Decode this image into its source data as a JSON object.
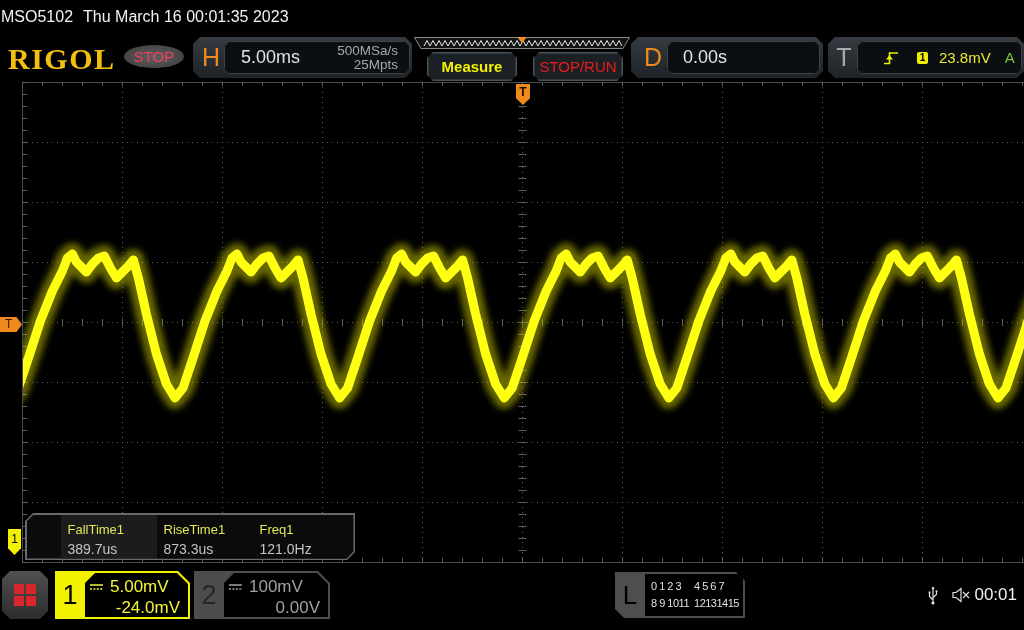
{
  "status_line": {
    "model": "MSO5102",
    "datetime": "Thu March 16 00:01:35 2023"
  },
  "toolbar": {
    "logo": "RIGOL",
    "run_state": {
      "label": "STOP",
      "running": false
    },
    "horizontal": {
      "label": "H",
      "timebase": "5.00ms",
      "sample_rate": "500MSa/s",
      "memory_depth": "25Mpts"
    },
    "buttons": [
      {
        "label": "Measure",
        "kind": "measure"
      },
      {
        "label": "STOP/RUN",
        "kind": "run_stop"
      }
    ],
    "delay": {
      "label": "D",
      "value": "0.00s"
    },
    "trigger": {
      "label": "T",
      "source": "1",
      "level": "23.8mV",
      "mode": "A"
    }
  },
  "display": {
    "trigger_position_marker": "T",
    "trigger_level_marker": "T",
    "channel_marker": "1",
    "measurements": [
      {
        "name": "FallTime1",
        "value": "389.7us",
        "selected": true
      },
      {
        "name": "RiseTime1",
        "value": "873.3us",
        "selected": false
      },
      {
        "name": "Freq1",
        "value": "121.0Hz",
        "selected": false
      }
    ]
  },
  "footer": {
    "channels": [
      {
        "number": "1",
        "scale": "5.00mV",
        "offset": "-24.0mV",
        "on": true
      },
      {
        "number": "2",
        "scale": "100mV",
        "offset": "0.00V",
        "on": false
      }
    ],
    "logic": {
      "label": "L",
      "channel_groups": [
        "0 1 2 3",
        "4 5 6 7",
        "8 9 1011",
        "12131415"
      ]
    },
    "mute": true,
    "elapsed": "00:01"
  }
}
